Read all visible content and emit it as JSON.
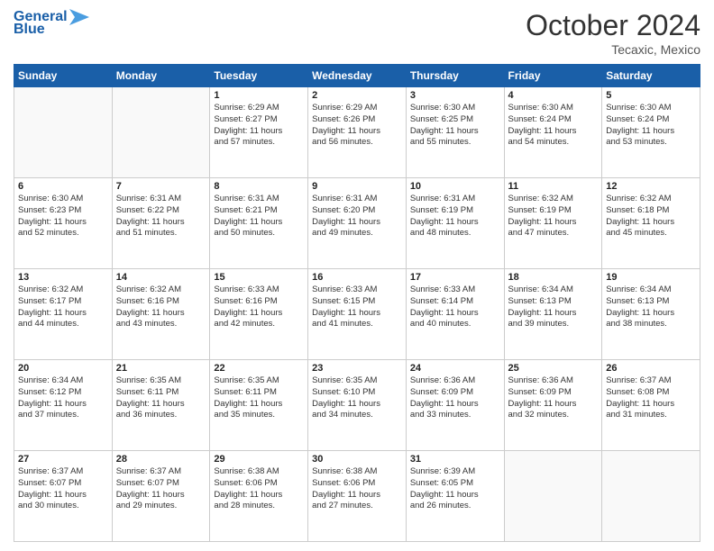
{
  "header": {
    "logo_line1": "General",
    "logo_line2": "Blue",
    "month": "October 2024",
    "location": "Tecaxic, Mexico"
  },
  "weekdays": [
    "Sunday",
    "Monday",
    "Tuesday",
    "Wednesday",
    "Thursday",
    "Friday",
    "Saturday"
  ],
  "weeks": [
    [
      {
        "day": "",
        "empty": true
      },
      {
        "day": "",
        "empty": true
      },
      {
        "day": "1",
        "lines": [
          "Sunrise: 6:29 AM",
          "Sunset: 6:27 PM",
          "Daylight: 11 hours",
          "and 57 minutes."
        ]
      },
      {
        "day": "2",
        "lines": [
          "Sunrise: 6:29 AM",
          "Sunset: 6:26 PM",
          "Daylight: 11 hours",
          "and 56 minutes."
        ]
      },
      {
        "day": "3",
        "lines": [
          "Sunrise: 6:30 AM",
          "Sunset: 6:25 PM",
          "Daylight: 11 hours",
          "and 55 minutes."
        ]
      },
      {
        "day": "4",
        "lines": [
          "Sunrise: 6:30 AM",
          "Sunset: 6:24 PM",
          "Daylight: 11 hours",
          "and 54 minutes."
        ]
      },
      {
        "day": "5",
        "lines": [
          "Sunrise: 6:30 AM",
          "Sunset: 6:24 PM",
          "Daylight: 11 hours",
          "and 53 minutes."
        ]
      }
    ],
    [
      {
        "day": "6",
        "lines": [
          "Sunrise: 6:30 AM",
          "Sunset: 6:23 PM",
          "Daylight: 11 hours",
          "and 52 minutes."
        ]
      },
      {
        "day": "7",
        "lines": [
          "Sunrise: 6:31 AM",
          "Sunset: 6:22 PM",
          "Daylight: 11 hours",
          "and 51 minutes."
        ]
      },
      {
        "day": "8",
        "lines": [
          "Sunrise: 6:31 AM",
          "Sunset: 6:21 PM",
          "Daylight: 11 hours",
          "and 50 minutes."
        ]
      },
      {
        "day": "9",
        "lines": [
          "Sunrise: 6:31 AM",
          "Sunset: 6:20 PM",
          "Daylight: 11 hours",
          "and 49 minutes."
        ]
      },
      {
        "day": "10",
        "lines": [
          "Sunrise: 6:31 AM",
          "Sunset: 6:19 PM",
          "Daylight: 11 hours",
          "and 48 minutes."
        ]
      },
      {
        "day": "11",
        "lines": [
          "Sunrise: 6:32 AM",
          "Sunset: 6:19 PM",
          "Daylight: 11 hours",
          "and 47 minutes."
        ]
      },
      {
        "day": "12",
        "lines": [
          "Sunrise: 6:32 AM",
          "Sunset: 6:18 PM",
          "Daylight: 11 hours",
          "and 45 minutes."
        ]
      }
    ],
    [
      {
        "day": "13",
        "lines": [
          "Sunrise: 6:32 AM",
          "Sunset: 6:17 PM",
          "Daylight: 11 hours",
          "and 44 minutes."
        ]
      },
      {
        "day": "14",
        "lines": [
          "Sunrise: 6:32 AM",
          "Sunset: 6:16 PM",
          "Daylight: 11 hours",
          "and 43 minutes."
        ]
      },
      {
        "day": "15",
        "lines": [
          "Sunrise: 6:33 AM",
          "Sunset: 6:16 PM",
          "Daylight: 11 hours",
          "and 42 minutes."
        ]
      },
      {
        "day": "16",
        "lines": [
          "Sunrise: 6:33 AM",
          "Sunset: 6:15 PM",
          "Daylight: 11 hours",
          "and 41 minutes."
        ]
      },
      {
        "day": "17",
        "lines": [
          "Sunrise: 6:33 AM",
          "Sunset: 6:14 PM",
          "Daylight: 11 hours",
          "and 40 minutes."
        ]
      },
      {
        "day": "18",
        "lines": [
          "Sunrise: 6:34 AM",
          "Sunset: 6:13 PM",
          "Daylight: 11 hours",
          "and 39 minutes."
        ]
      },
      {
        "day": "19",
        "lines": [
          "Sunrise: 6:34 AM",
          "Sunset: 6:13 PM",
          "Daylight: 11 hours",
          "and 38 minutes."
        ]
      }
    ],
    [
      {
        "day": "20",
        "lines": [
          "Sunrise: 6:34 AM",
          "Sunset: 6:12 PM",
          "Daylight: 11 hours",
          "and 37 minutes."
        ]
      },
      {
        "day": "21",
        "lines": [
          "Sunrise: 6:35 AM",
          "Sunset: 6:11 PM",
          "Daylight: 11 hours",
          "and 36 minutes."
        ]
      },
      {
        "day": "22",
        "lines": [
          "Sunrise: 6:35 AM",
          "Sunset: 6:11 PM",
          "Daylight: 11 hours",
          "and 35 minutes."
        ]
      },
      {
        "day": "23",
        "lines": [
          "Sunrise: 6:35 AM",
          "Sunset: 6:10 PM",
          "Daylight: 11 hours",
          "and 34 minutes."
        ]
      },
      {
        "day": "24",
        "lines": [
          "Sunrise: 6:36 AM",
          "Sunset: 6:09 PM",
          "Daylight: 11 hours",
          "and 33 minutes."
        ]
      },
      {
        "day": "25",
        "lines": [
          "Sunrise: 6:36 AM",
          "Sunset: 6:09 PM",
          "Daylight: 11 hours",
          "and 32 minutes."
        ]
      },
      {
        "day": "26",
        "lines": [
          "Sunrise: 6:37 AM",
          "Sunset: 6:08 PM",
          "Daylight: 11 hours",
          "and 31 minutes."
        ]
      }
    ],
    [
      {
        "day": "27",
        "lines": [
          "Sunrise: 6:37 AM",
          "Sunset: 6:07 PM",
          "Daylight: 11 hours",
          "and 30 minutes."
        ]
      },
      {
        "day": "28",
        "lines": [
          "Sunrise: 6:37 AM",
          "Sunset: 6:07 PM",
          "Daylight: 11 hours",
          "and 29 minutes."
        ]
      },
      {
        "day": "29",
        "lines": [
          "Sunrise: 6:38 AM",
          "Sunset: 6:06 PM",
          "Daylight: 11 hours",
          "and 28 minutes."
        ]
      },
      {
        "day": "30",
        "lines": [
          "Sunrise: 6:38 AM",
          "Sunset: 6:06 PM",
          "Daylight: 11 hours",
          "and 27 minutes."
        ]
      },
      {
        "day": "31",
        "lines": [
          "Sunrise: 6:39 AM",
          "Sunset: 6:05 PM",
          "Daylight: 11 hours",
          "and 26 minutes."
        ]
      },
      {
        "day": "",
        "empty": true
      },
      {
        "day": "",
        "empty": true
      }
    ]
  ]
}
